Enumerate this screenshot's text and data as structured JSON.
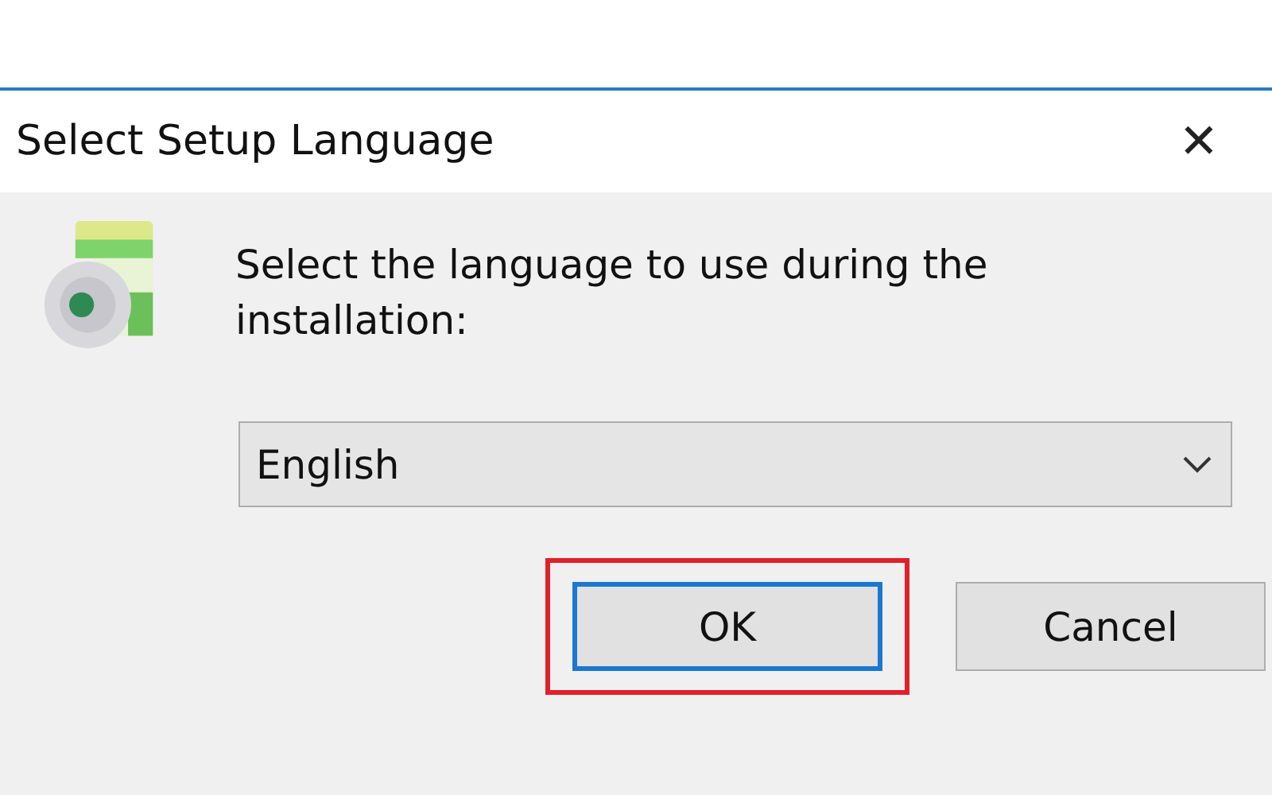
{
  "window": {
    "title": "Select Setup Language",
    "close": "✕"
  },
  "prompt": "Select the language to use during the installation:",
  "language": {
    "value": "English"
  },
  "buttons": [
    {
      "label": "OK",
      "default": true,
      "highlighted": true
    },
    {
      "label": "Cancel",
      "default": false,
      "highlighted": false
    }
  ]
}
